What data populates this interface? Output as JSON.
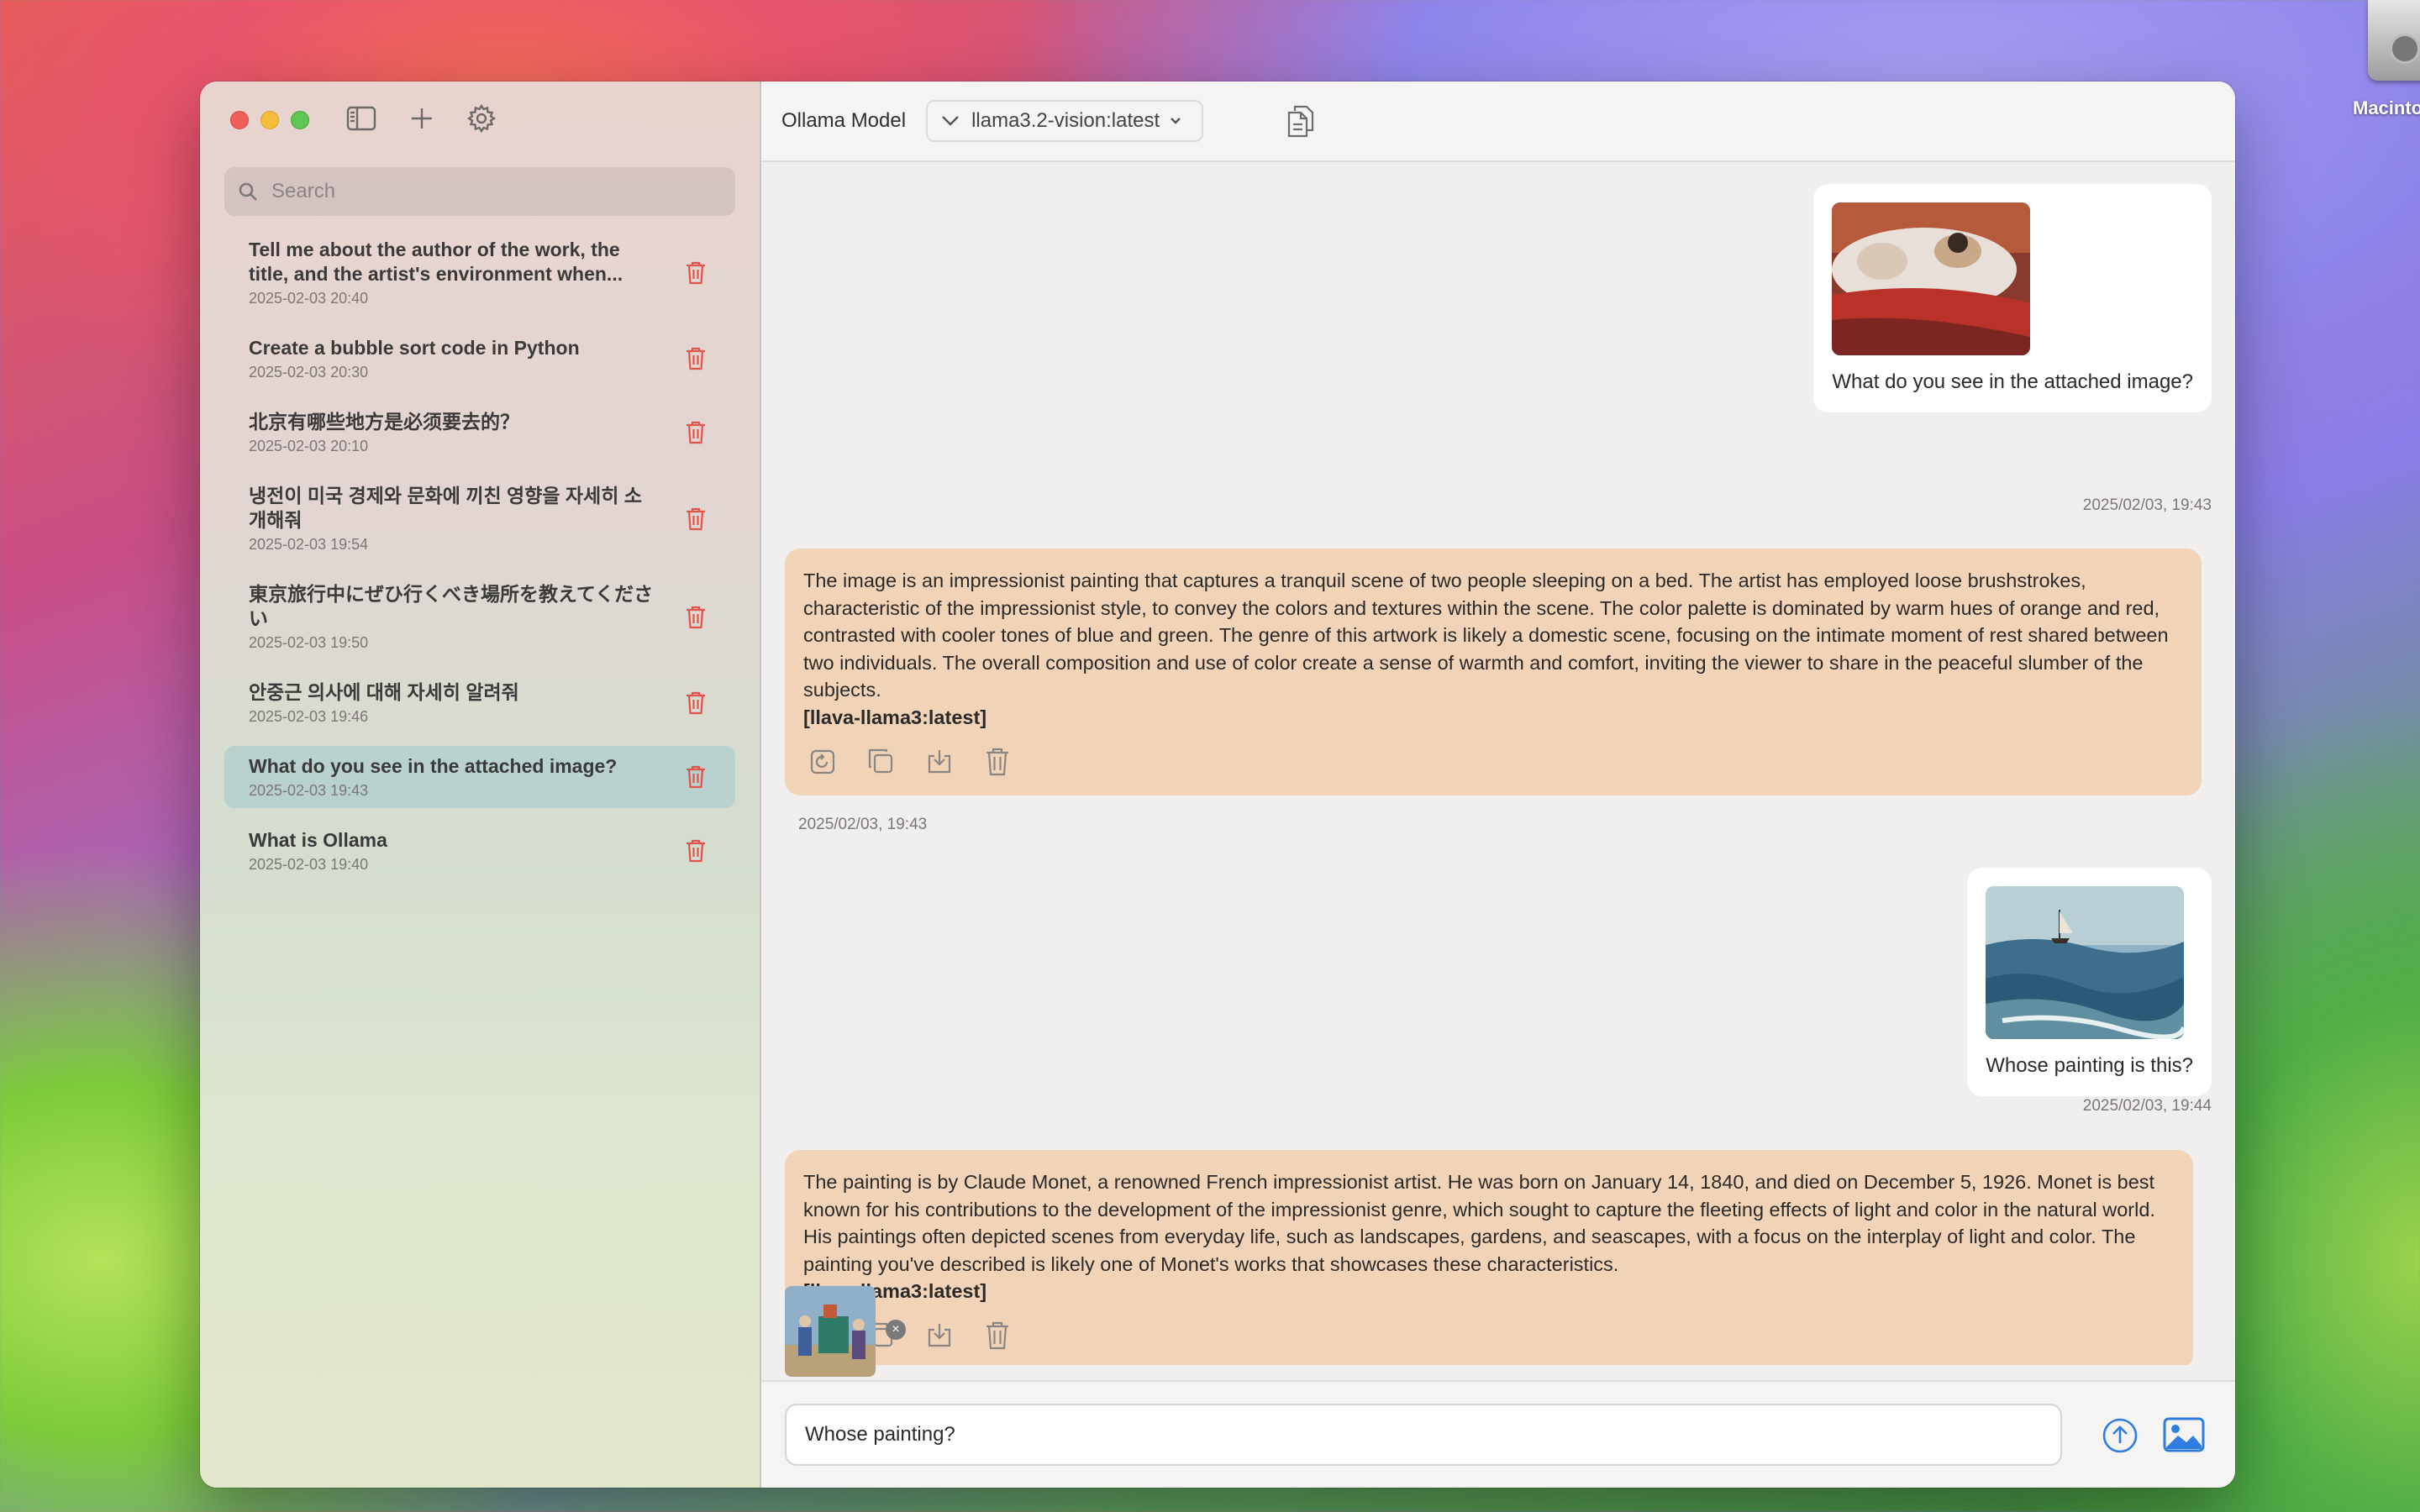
{
  "desktop": {
    "drive_label": "Macinto"
  },
  "sidebar": {
    "search_placeholder": "Search",
    "conversations": [
      {
        "title": "Tell me about the author of the work, the title, and the artist's environment when...",
        "date": "2025-02-03 20:40"
      },
      {
        "title": "Create a bubble sort code in Python",
        "date": "2025-02-03 20:30"
      },
      {
        "title": "北京有哪些地方是必须要去的？",
        "date": "2025-02-03 20:10"
      },
      {
        "title": "냉전이 미국 경제와 문화에 끼친 영향을 자세히 소개해줘",
        "date": "2025-02-03 19:54"
      },
      {
        "title": "東京旅行中にぜひ行くべき場所を教えてください",
        "date": "2025-02-03 19:50"
      },
      {
        "title": "안중근 의사에 대해 자세히 알려줘",
        "date": "2025-02-03 19:46"
      },
      {
        "title": "What do you see in the attached image?",
        "date": "2025-02-03 19:43"
      },
      {
        "title": "What is Ollama",
        "date": "2025-02-03 19:40"
      }
    ]
  },
  "toolbar": {
    "model_label": "Ollama Model",
    "model_value": "llama3.2-vision:latest"
  },
  "chat": {
    "msg1": {
      "text": "What do you see in the attached image?",
      "time": "2025/02/03, 19:43"
    },
    "reply1": {
      "text": "The image is an impressionist painting that captures a tranquil scene of two people sleeping on a bed. The artist has employed loose brushstrokes, characteristic of the impressionist style, to convey the colors and textures within the scene. The color palette is dominated by warm hues of orange and red, contrasted with cooler tones of blue and green. The genre of this artwork is likely a domestic scene, focusing on the intimate moment of rest shared between two individuals. The overall composition and use of color create a sense of warmth and comfort, inviting the viewer to share in the peaceful slumber of the subjects.",
      "model": "[llava-llama3:latest]",
      "time": "2025/02/03, 19:43"
    },
    "msg2": {
      "text": "Whose painting is this?",
      "time": "2025/02/03, 19:44"
    },
    "reply2": {
      "text": "The painting is by Claude Monet, a renowned French impressionist artist. He was born on January 14, 1840, and died on December 5, 1926. Monet is best known for his contributions to the development of the impressionist genre, which sought to capture the fleeting effects of light and color in the natural world. His paintings often depicted scenes from everyday life, such as landscapes, gardens, and seascapes, with a focus on the interplay of light and color. The painting you've described is likely one of Monet's works that showcases these characteristics.",
      "model": "[llava-llama3:latest]"
    }
  },
  "composer": {
    "value": "Whose painting?"
  }
}
